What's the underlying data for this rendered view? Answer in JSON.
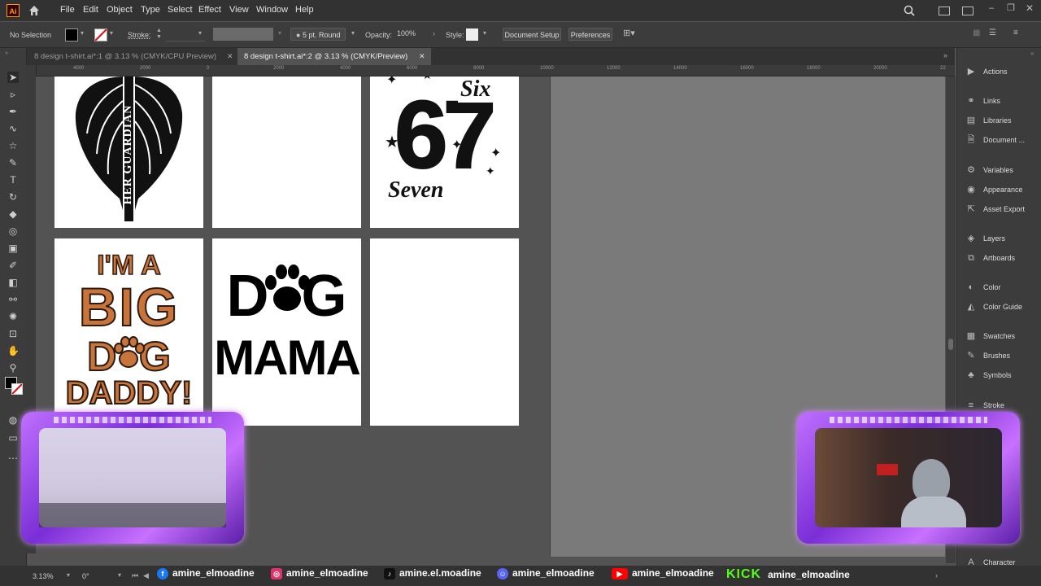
{
  "app": {
    "logo": "Ai"
  },
  "menu": [
    "File",
    "Edit",
    "Object",
    "Type",
    "Select",
    "Effect",
    "View",
    "Window",
    "Help"
  ],
  "control_bar": {
    "selection": "No Selection",
    "stroke_label": "Stroke:",
    "brush": "5 pt. Round",
    "opacity_label": "Opacity:",
    "opacity_value": "100%",
    "style_label": "Style:",
    "document_setup": "Document Setup",
    "preferences": "Preferences"
  },
  "tabs": [
    {
      "label": "8 design t-shirt.ai*:1 @ 3.13 % (CMYK/CPU Preview)",
      "active": false
    },
    {
      "label": "8 design t-shirt.ai*:2 @ 3.13 % (CMYK/Preview)",
      "active": true
    }
  ],
  "ruler_top": [
    "4000",
    "2000",
    "0",
    "2000",
    "4000",
    "6000",
    "8000",
    "10000",
    "12000",
    "14000",
    "16000",
    "18000",
    "20000",
    "22"
  ],
  "artboards": {
    "guardian": {
      "text": "HER GUARDIAN"
    },
    "six_seven": {
      "big": "67",
      "small_top": "Six",
      "small_bottom": "Seven"
    },
    "big_dog": {
      "line1": "I'M A",
      "line2": "BIG",
      "line3": "D  G",
      "line4": "DADDY!"
    },
    "dog_mama": {
      "line1": "D  G",
      "line2": "MAMA"
    }
  },
  "dock": {
    "items": [
      {
        "label": "Actions",
        "icon": "play-icon"
      },
      {
        "label": "Links",
        "icon": "link-icon"
      },
      {
        "label": "Libraries",
        "icon": "libraries-icon"
      },
      {
        "label": "Document ...",
        "icon": "document-icon"
      },
      {
        "label": "Variables",
        "icon": "variables-icon"
      },
      {
        "label": "Appearance",
        "icon": "appearance-icon"
      },
      {
        "label": "Asset Export",
        "icon": "export-icon"
      },
      {
        "label": "Layers",
        "icon": "layers-icon"
      },
      {
        "label": "Artboards",
        "icon": "artboards-icon"
      },
      {
        "label": "Color",
        "icon": "color-icon"
      },
      {
        "label": "Color Guide",
        "icon": "color-guide-icon"
      },
      {
        "label": "Swatches",
        "icon": "swatches-icon"
      },
      {
        "label": "Brushes",
        "icon": "brushes-icon"
      },
      {
        "label": "Symbols",
        "icon": "symbols-icon"
      },
      {
        "label": "Stroke",
        "icon": "stroke-icon"
      },
      {
        "label": "Character",
        "icon": "character-icon"
      }
    ]
  },
  "status": {
    "zoom": "3.13%",
    "rotation": "0°"
  },
  "socials": [
    {
      "platform": "facebook",
      "handle": "amine_elmoadine",
      "color": "#1877f2"
    },
    {
      "platform": "instagram",
      "handle": "amine_elmoadine",
      "color": "#e1306c"
    },
    {
      "platform": "tiktok",
      "handle": "amine.el.moadine",
      "color": "#111111"
    },
    {
      "platform": "discord",
      "handle": "amine_elmoadine",
      "color": "#5865f2"
    },
    {
      "platform": "youtube",
      "handle": "amine_elmoadine",
      "color": "#ff0000"
    },
    {
      "platform": "kick",
      "label": "KICK",
      "handle": "amine_elmoadine",
      "color": "#53fc18"
    }
  ],
  "colors": {
    "accent_orange": "#c8743a",
    "frame_purple": "#b866ff"
  }
}
